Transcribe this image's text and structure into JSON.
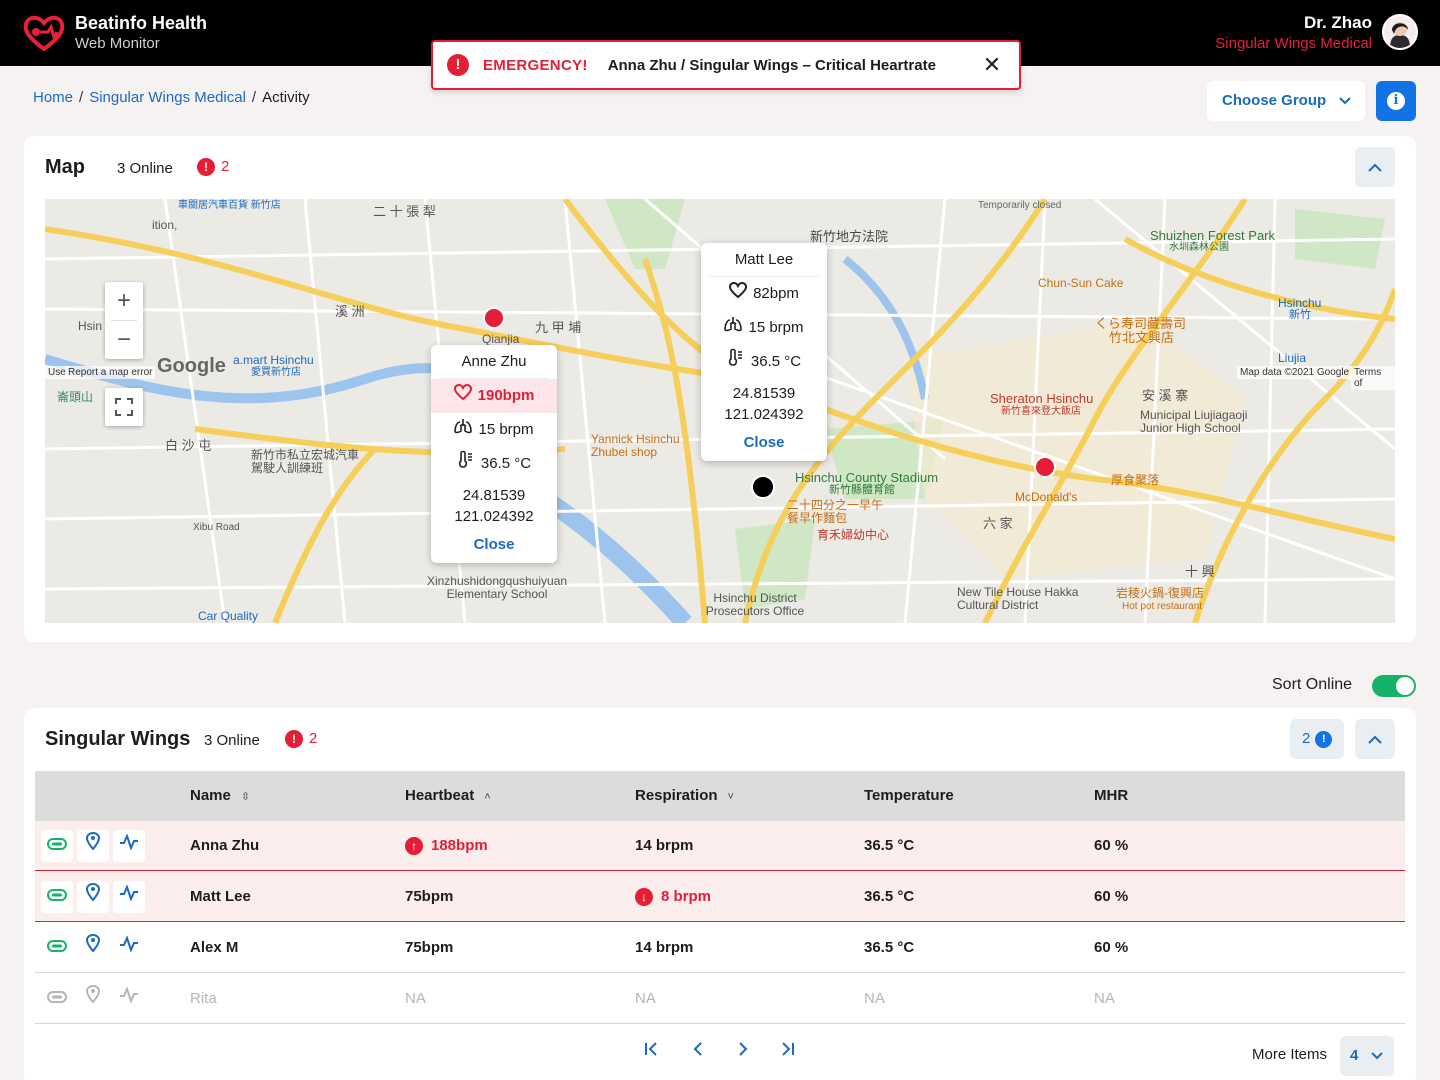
{
  "app": {
    "name": "Beatinfo Health",
    "subtitle": "Web Monitor"
  },
  "user": {
    "name": "Dr. Zhao",
    "org": "Singular Wings Medical"
  },
  "emergency": {
    "label": "EMERGENCY!",
    "message": "Anna Zhu / Singular Wings – Critical Heartrate"
  },
  "breadcrumb": {
    "home": "Home",
    "org": "Singular Wings Medical",
    "current": "Activity",
    "sep": "/"
  },
  "group_select": {
    "label": "Choose Group"
  },
  "map_card": {
    "title": "Map",
    "online": "3 Online",
    "alerts": "2",
    "labels": {
      "google": "Google",
      "report": "Report a map error",
      "mapdata": "Map data ©2021 Google",
      "terms": "Terms of",
      "use": "Use",
      "pois": [
        "車關居汽車百貨 新竹店",
        "二 十 張 犁",
        "新竹地方法院",
        "Temporarily closed",
        "Shuizhen Forest Park",
        "水圳森林公園",
        "Chun-Sun Cake",
        "くら寿司藏壽司",
        "竹北文興店",
        "Hsinchu",
        "新竹",
        "Liujia",
        "a.mart Hsinchu",
        "愛買新竹店",
        "崙頭山",
        "白 沙 屯",
        "新竹市私立宏城汽車駕駛人訓練班",
        "Yannick Hsinchu Zhubei shop",
        "Hsinchu County Stadium",
        "新竹縣體育館",
        "二十四分之一早午餐早作麵包",
        "育禾婦幼中心",
        "Sheraton Hsinchu",
        "新竹喜來登大飯店",
        "Municipal Liujiagaoji Junior High School",
        "安 溪 寨",
        "厚食聚落",
        "McDonald's",
        "六 家",
        "New Tile House Hakka Cultural District",
        "岩稜火鍋-復興店",
        "Hot pot restaurant",
        "十 興",
        "Xinzhushidongqushuiyuan Elementary School",
        "Hsinchu District Prosecutors Office",
        "Xibu Road",
        "Car Quality",
        "溪 洲",
        "九 甲 埔",
        "Qianjia",
        "Hsin",
        "ition,"
      ]
    },
    "popups": [
      {
        "name": "Anne Zhu",
        "heartbeat": "190bpm",
        "respiration": "15 brpm",
        "temperature": "36.5 °C",
        "lat": "24.81539",
        "lng": "121.024392",
        "close": "Close"
      },
      {
        "name": "Matt Lee",
        "heartbeat": "82bpm",
        "respiration": "15 brpm",
        "temperature": "36.5 °C",
        "lat": "24.81539",
        "lng": "121.024392",
        "close": "Close"
      }
    ]
  },
  "sort_online": {
    "label": "Sort Online",
    "enabled": true
  },
  "group_card": {
    "title": "Singular Wings",
    "online": "3 Online",
    "alerts": "2",
    "badge_count": "2",
    "columns": [
      "Name",
      "Heartbeat",
      "Respiration",
      "Temperature",
      "MHR"
    ],
    "rows": [
      {
        "name": "Anna Zhu",
        "heartbeat": "188bpm",
        "respiration": "14 brpm",
        "temperature": "36.5 °C",
        "mhr": "60 %"
      },
      {
        "name": "Matt Lee",
        "heartbeat": "75bpm",
        "respiration": "8 brpm",
        "temperature": "36.5 °C",
        "mhr": "60 %"
      },
      {
        "name": "Alex M",
        "heartbeat": "75bpm",
        "respiration": "14 brpm",
        "temperature": "36.5 °C",
        "mhr": "60 %"
      },
      {
        "name": "Rita",
        "heartbeat": "NA",
        "respiration": "NA",
        "temperature": "NA",
        "mhr": "NA"
      }
    ],
    "more_items_label": "More Items",
    "more_items_value": "4"
  },
  "colors": {
    "accent": "#1273e6",
    "alert": "#e41e35",
    "online": "#17b26a"
  }
}
